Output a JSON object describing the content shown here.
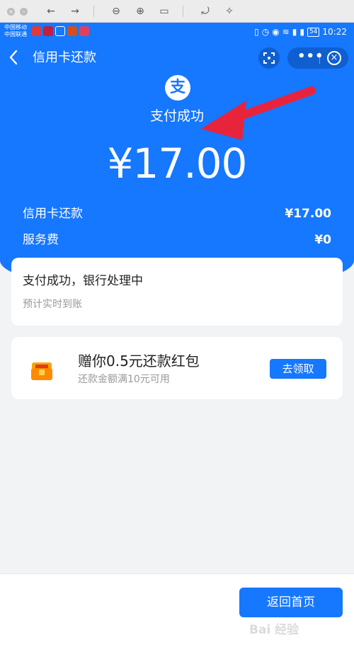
{
  "status_bar": {
    "carrier1": "中国移动",
    "carrier2": "中国联通",
    "battery": "54",
    "time": "10:22"
  },
  "nav": {
    "title": "信用卡还款"
  },
  "hero": {
    "status": "支付成功",
    "amount": "¥17.00",
    "rows": [
      {
        "label": "信用卡还款",
        "value": "¥17.00"
      },
      {
        "label": "服务费",
        "value": "¥0"
      }
    ]
  },
  "progress_card": {
    "title": "支付成功，银行处理中",
    "subtitle": "预计实时到账"
  },
  "promo_card": {
    "title": "赠你0.5元还款红包",
    "subtitle": "还款金额满10元可用",
    "button": "去领取"
  },
  "footer": {
    "home_button": "返回首页"
  },
  "watermark": "Bai 经验",
  "colors": {
    "primary": "#1677ff",
    "page_bg": "#f2f3f5",
    "arrow": "#e8243c"
  }
}
